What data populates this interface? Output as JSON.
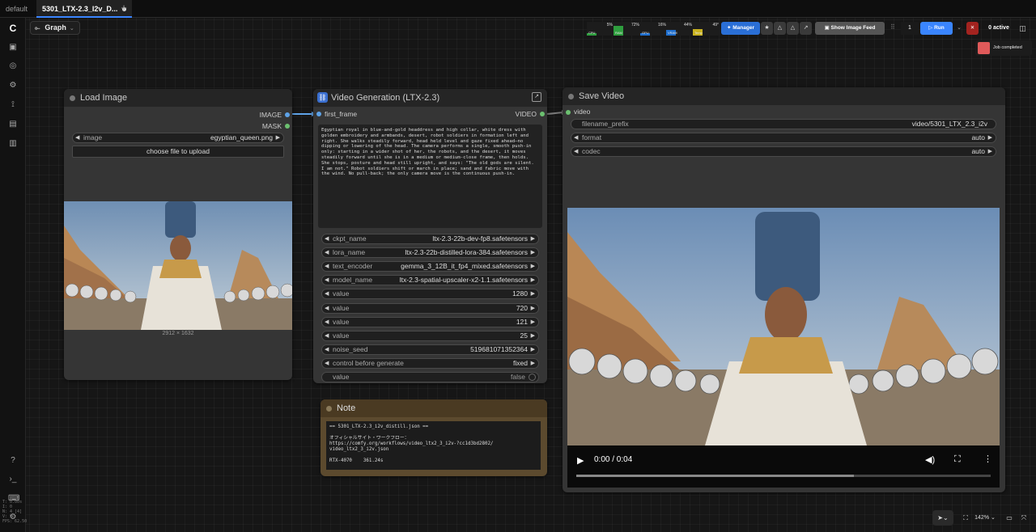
{
  "tabs": [
    {
      "label": "default"
    },
    {
      "label": "5301_LTX-2.3_I2v_D..."
    }
  ],
  "graph_button": {
    "label": "Graph"
  },
  "meters": [
    {
      "label": "CPU",
      "value": "5%",
      "level": 0.05,
      "color": "#2e9e3e"
    },
    {
      "label": "RAM",
      "value": "72%",
      "level": 0.72,
      "color": "#2e9e3e"
    },
    {
      "label": "GPU",
      "value": "16%",
      "level": 0.16,
      "color": "#1f6fcf"
    },
    {
      "label": "VRAM",
      "value": "44%",
      "level": 0.44,
      "color": "#1f6fcf"
    },
    {
      "label": "Temp",
      "value": "49°",
      "level": 0.49,
      "color": "#c9b21f"
    }
  ],
  "toolbar": {
    "manager": "Manager",
    "show_image_feed": "Show Image Feed",
    "queue_count": "1",
    "run": "Run",
    "active": "0 active",
    "job_completed": "Job completed"
  },
  "load_image": {
    "title": "Load Image",
    "out_image": "IMAGE",
    "out_mask": "MASK",
    "image_label": "image",
    "image_value": "egyptian_queen.png",
    "upload_label": "choose file to upload",
    "dimensions": "2912 × 1632"
  },
  "video_gen": {
    "title": "Video Generation (LTX-2.3)",
    "in_first_frame": "first_frame",
    "out_video": "VIDEO",
    "prompt": "Egyptian royal in blue-and-gold headdress and high collar, white dress with golden embroidery and armbands, desert, robot soldiers in formation left and right. She walks steadily forward, head held level and gaze fixed ahead—no dipping or lowering of the head. The camera performs a single, smooth push-in only: starting in a wider shot of her, the robots, and the desert, it moves steadily forward until she is in a medium or medium-close frame, then holds. She stops, posture and head still upright, and says: \"The old gods are silent. I am not.\" Robot soldiers shift or march in place; sand and fabric move with the wind. No pull-back; the only camera move is the continuous push-in.",
    "widgets": [
      {
        "label": "ckpt_name",
        "value": "ltx-2.3-22b-dev-fp8.safetensors"
      },
      {
        "label": "lora_name",
        "value": "ltx-2.3-22b-distilled-lora-384.safetensors"
      },
      {
        "label": "text_encoder",
        "value": "gemma_3_12B_it_fp4_mixed.safetensors"
      },
      {
        "label": "model_name",
        "value": "ltx-2.3-spatial-upscaler-x2-1.1.safetensors"
      },
      {
        "label": "value",
        "value": "1280"
      },
      {
        "label": "value",
        "value": "720"
      },
      {
        "label": "value",
        "value": "121"
      },
      {
        "label": "value",
        "value": "25"
      },
      {
        "label": "noise_seed",
        "value": "519681071352364"
      },
      {
        "label": "control before generate",
        "value": "fixed"
      },
      {
        "label": "value",
        "value": "false"
      }
    ]
  },
  "note": {
    "title": "Note",
    "body": "== 5301_LTX-2.3_i2v_distill.json ==\n\nオフィシャルサイト・ワークフロー：\nhttps://comfy.org/workflows/video_ltx2_3_i2v-?cc1d3bd2802/\nvideo_ltx2_3_i2v.json\n\nRTX-4070    361.24s"
  },
  "save_video": {
    "title": "Save Video",
    "in_video": "video",
    "widgets": [
      {
        "label": "filename_prefix",
        "value": "video/5301_LTX_2.3_i2v"
      },
      {
        "label": "format",
        "value": "auto"
      },
      {
        "label": "codec",
        "value": "auto"
      }
    ],
    "time": "0:00 / 0:04",
    "progress": 0.0
  },
  "bottom_bar": {
    "zoom": "142%"
  },
  "side_stats": "T: 0.00s\nI: 0\nN: 4 [4]\nV: 9\nFPS: 62.50"
}
